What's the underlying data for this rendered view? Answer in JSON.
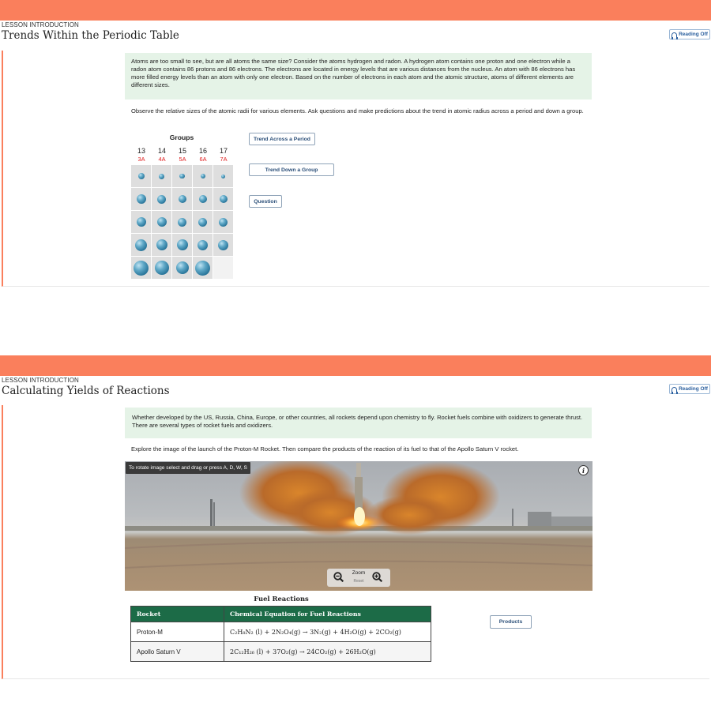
{
  "lesson1": {
    "label": "LESSON INTRODUCTION",
    "title": "Trends Within the Periodic Table",
    "reading": "Reading Off",
    "intro": "Atoms are too small to see, but are all atoms the same size? Consider the atoms hydrogen and radon. A hydrogen atom contains one proton and one electron while a radon atom contains 86 protons and 86 electrons. The electrons are located in energy levels that are various distances from the nucleus. An atom with 86 electrons has more filled energy levels than an atom with only one electron. Based on the number of electrons in each atom and the atomic structure, atoms of different elements are different sizes.",
    "instruction": "Observe the relative sizes of the atomic radii for various elements. Ask questions and make predictions about the trend in atomic radius across a period and down a group.",
    "groups_title": "Groups",
    "groups": [
      {
        "num": "13",
        "sub": "3A"
      },
      {
        "num": "14",
        "sub": "4A"
      },
      {
        "num": "15",
        "sub": "5A"
      },
      {
        "num": "16",
        "sub": "6A"
      },
      {
        "num": "17",
        "sub": "7A"
      }
    ],
    "buttons": {
      "trend_period": "Trend Across a Period",
      "trend_group": "Trend Down a Group",
      "question": "Question"
    },
    "atom_colors": {
      "light": "#bfe3f2",
      "dark": "#1f6c92"
    }
  },
  "lesson2": {
    "label": "LESSON INTRODUCTION",
    "title": "Calculating Yields of Reactions",
    "reading": "Reading Off",
    "intro": "Whether developed by the US, Russia, China, Europe, or other countries, all rockets depend upon chemistry to fly. Rocket fuels combine with oxidizers to generate thrust. There are several types of rocket fuels and oxidizers.",
    "instruction": "Explore the image of the launch of the Proton-M Rocket. Then compare the products of the reaction of its fuel to that of the Apollo Saturn V rocket.",
    "scene_tip": "To rotate image select and drag or press A, D, W, S",
    "info": "i",
    "zoom": "Zoom",
    "reset": "Reset",
    "table_title": "Fuel Reactions",
    "table_headers": [
      "Rocket",
      "Chemical Equation for Fuel Reactions"
    ],
    "rows": [
      {
        "rocket": "Proton-M",
        "equation": "C₂H₈N₂ (l) + 2N₂O₄(g) → 3N₂(g) + 4H₂O(g) + 2CO₂(g)"
      },
      {
        "rocket": "Apollo Saturn V",
        "equation": "2C₁₂H₂₆ (l) + 37O₂(g) → 24CO₂(g) + 26H₂O(g)"
      }
    ],
    "products_button": "Products",
    "header_color": "#1c6b47"
  },
  "accent_color": "#fa7f5c"
}
